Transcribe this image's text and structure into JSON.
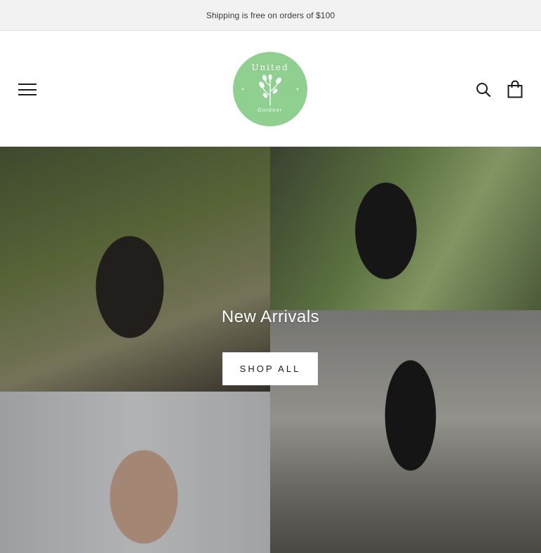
{
  "announcement": {
    "text": "Shipping is free on orders of $100"
  },
  "header": {
    "menu_icon": "hamburger-menu-icon",
    "logo": {
      "top_text": "United",
      "bottom_text": "Outdoor",
      "color": "#8fcf8f"
    },
    "search_icon": "search-icon",
    "cart_icon": "shopping-bag-icon"
  },
  "hero": {
    "title": "New Arrivals",
    "button_label": "SHOP ALL"
  },
  "colors": {
    "accent": "#8fcf8f",
    "text": "#1c1c1c",
    "announce_bg": "#f2f2f2"
  }
}
